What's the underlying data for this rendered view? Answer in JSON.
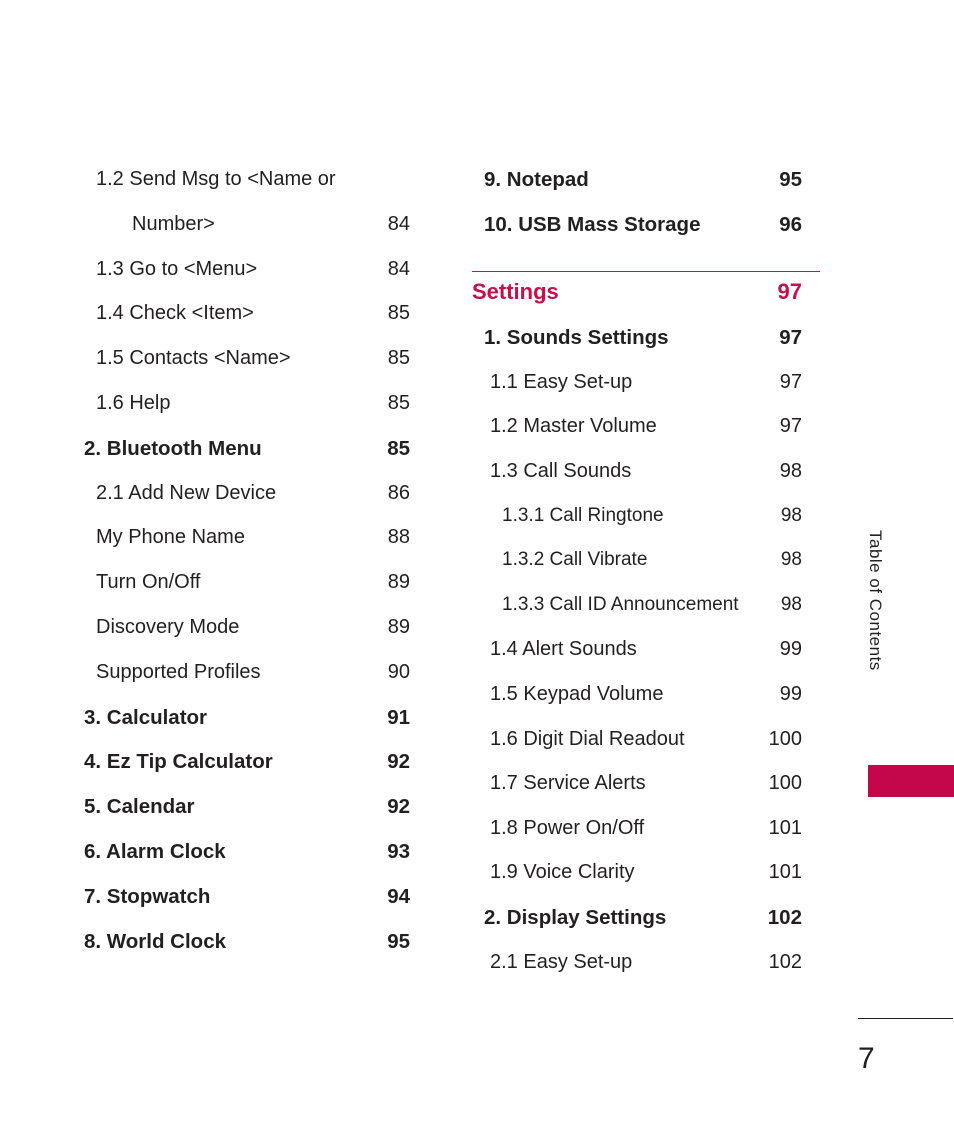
{
  "document": {
    "side_tab_label": "Table of Contents",
    "folio": "7",
    "accent_color": "#c4104b",
    "tab_color": "#c4064b",
    "text_color": "#231f20"
  },
  "left_column": {
    "entries": [
      {
        "title": "1.2 Send Msg to <Name or",
        "page": "",
        "level": 2,
        "wrap": false
      },
      {
        "title": "Number>",
        "page": "84",
        "level": 2,
        "wrap": true
      },
      {
        "title": "1.3 Go to <Menu>",
        "page": "84",
        "level": 2,
        "wrap": false
      },
      {
        "title": "1.4 Check <Item>",
        "page": "85",
        "level": 2,
        "wrap": false
      },
      {
        "title": "1.5 Contacts <Name>",
        "page": "85",
        "level": 2,
        "wrap": false
      },
      {
        "title": "1.6 Help",
        "page": "85",
        "level": 2,
        "wrap": false
      },
      {
        "title": "2. Bluetooth Menu",
        "page": "85",
        "level": 1,
        "wrap": false
      },
      {
        "title": "2.1 Add New Device",
        "page": "86",
        "level": 2,
        "wrap": false
      },
      {
        "title": "My Phone Name",
        "page": "88",
        "level": 2,
        "wrap": false
      },
      {
        "title": "Turn On/Off",
        "page": "89",
        "level": 2,
        "wrap": false
      },
      {
        "title": "Discovery Mode",
        "page": "89",
        "level": 2,
        "wrap": false
      },
      {
        "title": "Supported Profiles",
        "page": "90",
        "level": 2,
        "wrap": false
      },
      {
        "title": "3. Calculator",
        "page": "91",
        "level": 1,
        "wrap": false
      },
      {
        "title": "4. Ez Tip Calculator",
        "page": "92",
        "level": 1,
        "wrap": false
      },
      {
        "title": "5. Calendar",
        "page": "92",
        "level": 1,
        "wrap": false
      },
      {
        "title": "6. Alarm Clock",
        "page": "93",
        "level": 1,
        "wrap": false
      },
      {
        "title": "7. Stopwatch",
        "page": "94",
        "level": 1,
        "wrap": false
      },
      {
        "title": "8. World Clock",
        "page": "95",
        "level": 1,
        "wrap": false
      }
    ]
  },
  "right_column": {
    "pre_section_entries": [
      {
        "title": "9. Notepad",
        "page": "95",
        "level": 1
      },
      {
        "title": "10. USB Mass Storage",
        "page": "96",
        "level": 1
      }
    ],
    "section": {
      "title": "Settings",
      "page": "97"
    },
    "post_section_entries": [
      {
        "title": "1. Sounds Settings",
        "page": "97",
        "level": 1
      },
      {
        "title": "1.1 Easy Set-up",
        "page": "97",
        "level": 2
      },
      {
        "title": "1.2 Master Volume",
        "page": "97",
        "level": 2
      },
      {
        "title": "1.3 Call Sounds",
        "page": "98",
        "level": 2
      },
      {
        "title": "1.3.1 Call Ringtone",
        "page": "98",
        "level": 3
      },
      {
        "title": "1.3.2 Call Vibrate",
        "page": "98",
        "level": 3
      },
      {
        "title": "1.3.3 Call ID Announcement",
        "page": "98",
        "level": 3
      },
      {
        "title": "1.4 Alert Sounds",
        "page": "99",
        "level": 2
      },
      {
        "title": "1.5 Keypad Volume",
        "page": "99",
        "level": 2
      },
      {
        "title": "1.6 Digit Dial Readout",
        "page": "100",
        "level": 2
      },
      {
        "title": "1.7 Service Alerts",
        "page": "100",
        "level": 2
      },
      {
        "title": "1.8 Power On/Off",
        "page": "101",
        "level": 2
      },
      {
        "title": "1.9 Voice Clarity",
        "page": "101",
        "level": 2
      },
      {
        "title": "2. Display Settings",
        "page": "102",
        "level": 1
      },
      {
        "title": "2.1 Easy Set-up",
        "page": "102",
        "level": 2
      }
    ]
  }
}
